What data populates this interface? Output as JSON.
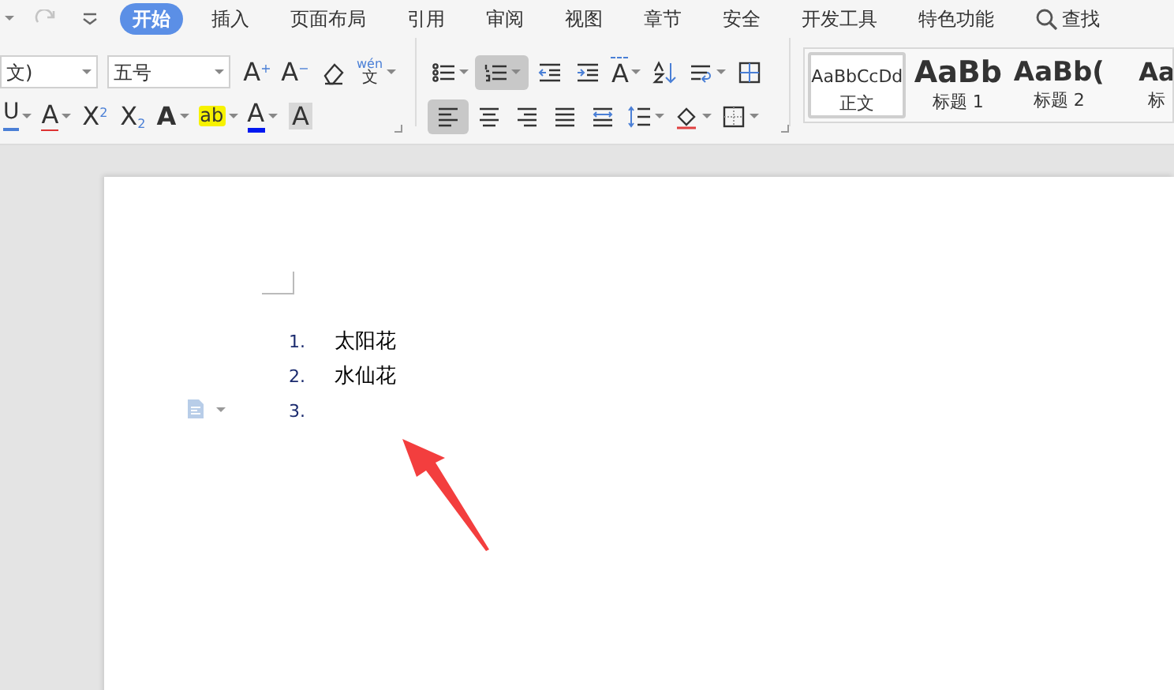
{
  "quick_access": [
    {
      "kind": "caret"
    },
    {
      "kind": "redo",
      "disabled": true
    },
    {
      "kind": "customize"
    }
  ],
  "tabs": [
    {
      "label": "开始",
      "selected": true
    },
    {
      "label": "插入",
      "selected": false
    },
    {
      "label": "页面布局",
      "selected": false
    },
    {
      "label": "引用",
      "selected": false
    },
    {
      "label": "审阅",
      "selected": false
    },
    {
      "label": "视图",
      "selected": false
    },
    {
      "label": "章节",
      "selected": false
    },
    {
      "label": "安全",
      "selected": false
    },
    {
      "label": "开发工具",
      "selected": false
    },
    {
      "label": "特色功能",
      "selected": false
    }
  ],
  "search": {
    "label": "查找"
  },
  "ribbon": {
    "row_1": [
      {
        "kind": "field",
        "value": "文)"
      },
      {
        "kind": "field",
        "value": "五号"
      },
      {
        "kind": "grow-font",
        "text": "A$^{+}$"
      },
      {
        "kind": "shrink-font",
        "text": "A$^{−}$"
      },
      {
        "kind": "eraser",
        "selected": false
      },
      {
        "kind": "phonetic",
        "ruby": "wén",
        "base": "文"
      },
      {
        "kind": "divider"
      },
      {
        "kind": "bullet-list",
        "selected": false
      },
      {
        "kind": "numbered-list",
        "selected": true
      },
      {
        "kind": "outdent",
        "selected": false
      },
      {
        "kind": "indent",
        "selected": false
      },
      {
        "kind": "text-direction",
        "text": "A"
      },
      {
        "kind": "sort",
        "selected": false
      },
      {
        "kind": "wrap",
        "selected": false
      },
      {
        "kind": "table-grid",
        "selected": false
      }
    ],
    "row_2": [
      {
        "kind": "underline",
        "text": "U"
      },
      {
        "kind": "strike",
        "text": "A"
      },
      {
        "kind": "superscript",
        "text": "X$^{2}$"
      },
      {
        "kind": "subscript",
        "text": "X$_{2}$"
      },
      {
        "kind": "outline",
        "text": "A"
      },
      {
        "kind": "highlight",
        "text": "ab"
      },
      {
        "kind": "font-color",
        "text": "A"
      },
      {
        "kind": "shaded",
        "text": "A"
      },
      {
        "kind": "launcher"
      },
      {
        "kind": "divider"
      },
      {
        "kind": "align-left",
        "selected": true
      },
      {
        "kind": "align-center",
        "selected": false
      },
      {
        "kind": "align-right",
        "selected": false
      },
      {
        "kind": "justify",
        "selected": false
      },
      {
        "kind": "distribute",
        "selected": false
      },
      {
        "kind": "line-spacing",
        "selected": false
      },
      {
        "kind": "shading",
        "selected": false
      },
      {
        "kind": "borders",
        "selected": false
      },
      {
        "kind": "launcher"
      }
    ],
    "styles": [
      {
        "kind": "body",
        "preview": "AaBbCcDd",
        "label": "正文",
        "selected": true
      },
      {
        "kind": "heading-1",
        "preview": "AaBb",
        "label": "标题 1",
        "selected": false
      },
      {
        "kind": "heading-2",
        "preview": "AaBb(",
        "label": "标题 2",
        "selected": false
      },
      {
        "kind": "heading-3",
        "preview": "Aa",
        "label": "标",
        "selected": false
      }
    ]
  },
  "document": {
    "list": [
      {
        "number": "1.",
        "text": "太阳花"
      },
      {
        "number": "2.",
        "text": "水仙花"
      },
      {
        "number": "3."
      }
    ]
  }
}
